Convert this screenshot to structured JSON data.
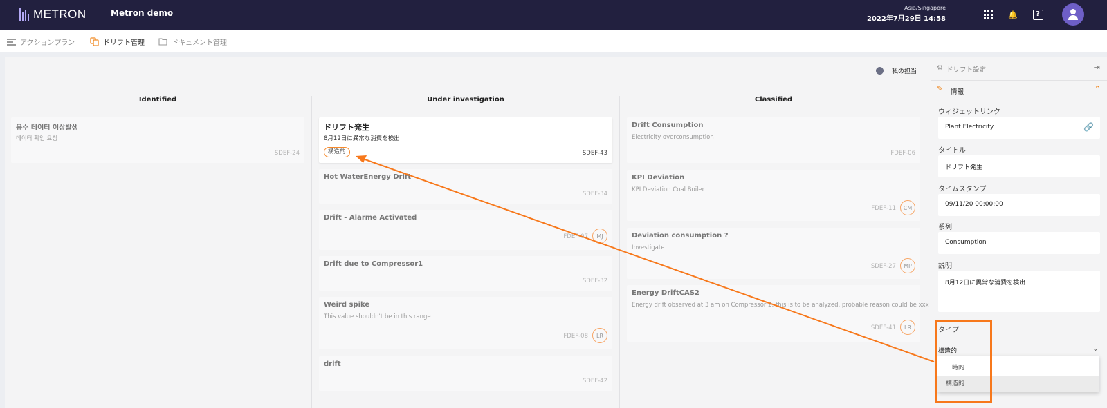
{
  "topbar": {
    "brand": "METRON",
    "app_name": "Metron demo",
    "timezone": "Asia/Singapore",
    "datetime": "2022年7月29日 14:58",
    "icons": [
      "apps-grid-icon",
      "bell-icon",
      "help-icon",
      "user-avatar-icon"
    ]
  },
  "nav": {
    "action_plan": "アクションプラン",
    "drift_management": "ドリフト管理",
    "document_management": "ドキュメント管理"
  },
  "board": {
    "my_items_label": "私の担当",
    "columns": [
      {
        "title": "Identified",
        "cards": [
          {
            "title": "용수 데이터 이상발생",
            "desc": "데이터 확인 요청",
            "id": "SDEF-24"
          }
        ]
      },
      {
        "title": "Under investigation",
        "cards": [
          {
            "title": "ドリフト発生",
            "desc": "8月12日に異常な消費を検出",
            "id": "SDEF-43",
            "tag": "構造的",
            "active": true
          },
          {
            "title": "Hot WaterEnergy Drift",
            "desc": "",
            "id": "SDEF-34"
          },
          {
            "title": "Drift - Alarme Activated",
            "desc": "",
            "id": "FDEF-07",
            "assignee": "MJ"
          },
          {
            "title": "Drift due to Compressor1",
            "desc": "",
            "id": "SDEF-32"
          },
          {
            "title": "Weird spike",
            "desc": "This value shouldn't be in this range",
            "id": "FDEF-08",
            "assignee": "LR"
          },
          {
            "title": "drift",
            "desc": "",
            "id": "SDEF-42"
          }
        ]
      },
      {
        "title": "Classified",
        "cards": [
          {
            "title": "Drift Consumption",
            "desc": "Electricity overconsumption",
            "id": "FDEF-06"
          },
          {
            "title": "KPI Deviation",
            "desc": "KPI Deviation Coal Boiler",
            "id": "FDEF-11",
            "assignee": "CM"
          },
          {
            "title": "Deviation consumption ?",
            "desc": "Investigate",
            "id": "SDEF-27",
            "assignee": "MP"
          },
          {
            "title": "Energy DriftCAS2",
            "desc": "Energy drift observed at 3 am on Compressor 2, this is to be analyzed, probable reason could be xxx",
            "id": "SDEF-41",
            "assignee": "LR"
          }
        ]
      }
    ]
  },
  "panel": {
    "title": "ドリフト設定",
    "section": "情報",
    "widget_link_label": "ウィジェットリンク",
    "widget_link_value": "Plant Electricity",
    "title_label": "タイトル",
    "title_value": "ドリフト発生",
    "timestamp_label": "タイムスタンプ",
    "timestamp_value": "09/11/20 00:00:00",
    "series_label": "系列",
    "series_value": "Consumption",
    "description_label": "説明",
    "description_value": "8月12日に異常な消費を検出",
    "type_label": "タイプ",
    "type_value": "構造的",
    "type_options": [
      "一時的",
      "構造的"
    ],
    "type_selected_index": 1
  },
  "annotation": {
    "color": "#f7781b"
  },
  "colors": {
    "topbar": "#22203f",
    "accent": "#f08a24",
    "avatar": "#6e5fc7"
  }
}
